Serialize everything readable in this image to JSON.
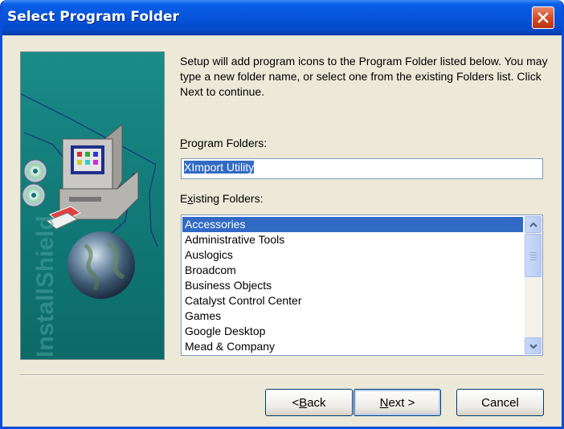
{
  "window": {
    "title": "Select Program Folder"
  },
  "graphic": {
    "brand_text": "InstallShield"
  },
  "description": "Setup will add program icons to the Program Folder listed below. You may type a new folder name, or select one from the existing Folders list.  Click Next to continue.",
  "program_folders": {
    "label_prefix": "",
    "label_accel": "P",
    "label_rest": "rogram Folders:",
    "value": "XImport Utility"
  },
  "existing_folders": {
    "label_prefix": "E",
    "label_accel": "x",
    "label_rest": "isting Folders:",
    "items": [
      "Accessories",
      "Administrative Tools",
      "Auslogics",
      "Broadcom",
      "Business Objects",
      "Catalyst Control Center",
      "Games",
      "Google Desktop",
      "Mead & Company"
    ],
    "selected_index": 0
  },
  "buttons": {
    "back": {
      "prefix": "< ",
      "accel": "B",
      "rest": "ack"
    },
    "next": {
      "prefix": "",
      "accel": "N",
      "rest": "ext >"
    },
    "cancel": {
      "label": "Cancel"
    }
  },
  "colors": {
    "title_bar": "#0654dc",
    "selection": "#316ac5",
    "dialog_bg": "#ece9d8",
    "graphic_bg": "#117a77"
  },
  "icons": {
    "close": "close-icon",
    "scroll_up": "chevron-up-icon",
    "scroll_down": "chevron-down-icon",
    "computer": "computer-icon",
    "globe": "globe-icon",
    "cd": "cd-icon"
  }
}
